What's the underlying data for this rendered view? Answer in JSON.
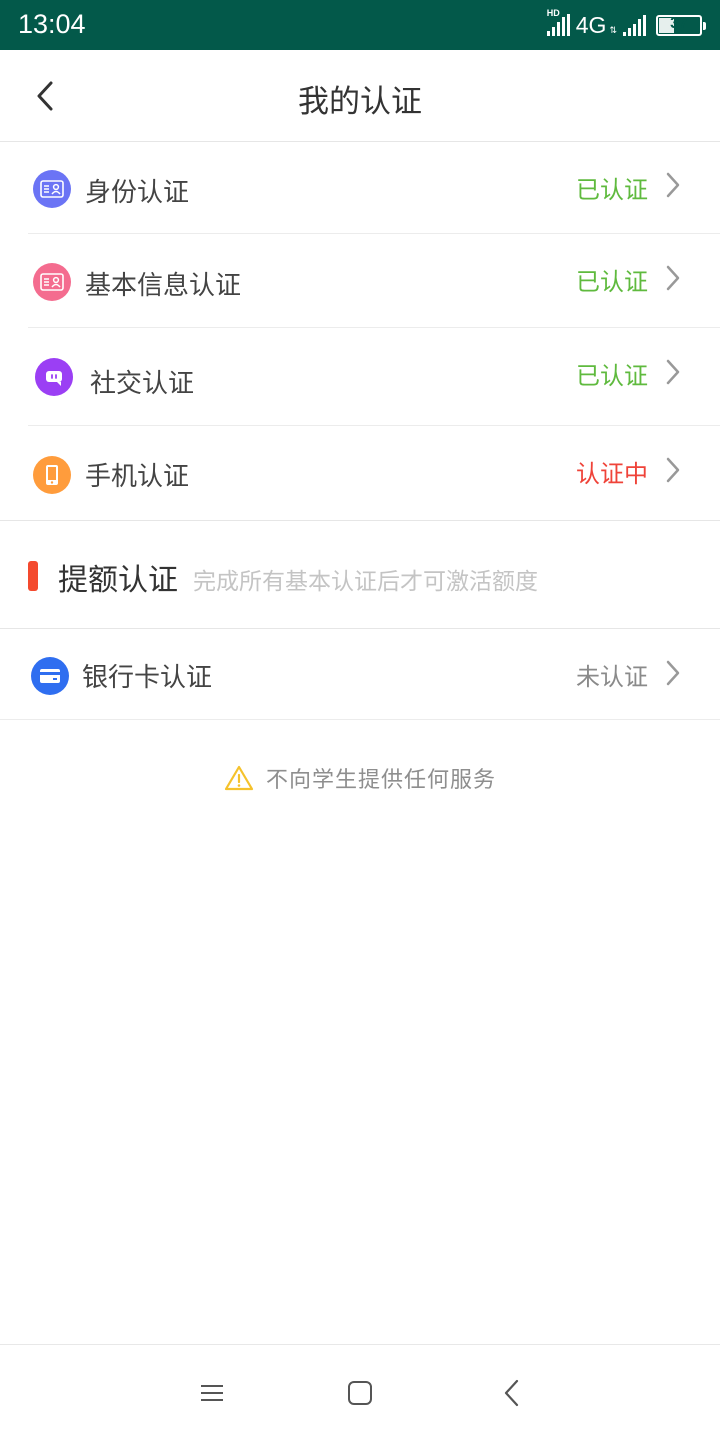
{
  "status_bar": {
    "time": "13:04",
    "hd_label": "HD",
    "network": "4G",
    "network_arrows": "⇅",
    "battery": "37",
    "battery_fraction": 0.37
  },
  "header": {
    "title": "我的认证",
    "back_icon": "chevron-left-icon"
  },
  "basic_items": [
    {
      "label": "身份认证",
      "status": "已认证",
      "status_color": "#5fba3e",
      "icon": "id-card-icon",
      "icon_color": "#6b74f5"
    },
    {
      "label": "基本信息认证",
      "status": "已认证",
      "status_color": "#5fba3e",
      "icon": "id-card-icon",
      "icon_color": "#f46c8f"
    },
    {
      "label": "社交认证",
      "status": "已认证",
      "status_color": "#5fba3e",
      "icon": "chat-bubble-icon",
      "icon_color": "#9b3ff4"
    },
    {
      "label": "手机认证",
      "status": "认证中",
      "status_color": "#ef4339",
      "icon": "phone-icon",
      "icon_color": "#ff9c3c"
    }
  ],
  "section": {
    "title": "提额认证",
    "subtitle": "完成所有基本认证后才可激活额度",
    "marker_color": "#f44a2e"
  },
  "extra_items": [
    {
      "label": "银行卡认证",
      "status": "未认证",
      "status_color": "#8a8a8a",
      "icon": "bank-card-icon",
      "icon_color": "#2f6ef0"
    }
  ],
  "notice": {
    "text": "不向学生提供任何服务",
    "icon": "warning-icon",
    "icon_color": "#f5c22c"
  },
  "system_nav": {
    "menu_icon": "menu-icon",
    "home_icon": "home-square-icon",
    "back_icon": "back-chevron-icon"
  }
}
